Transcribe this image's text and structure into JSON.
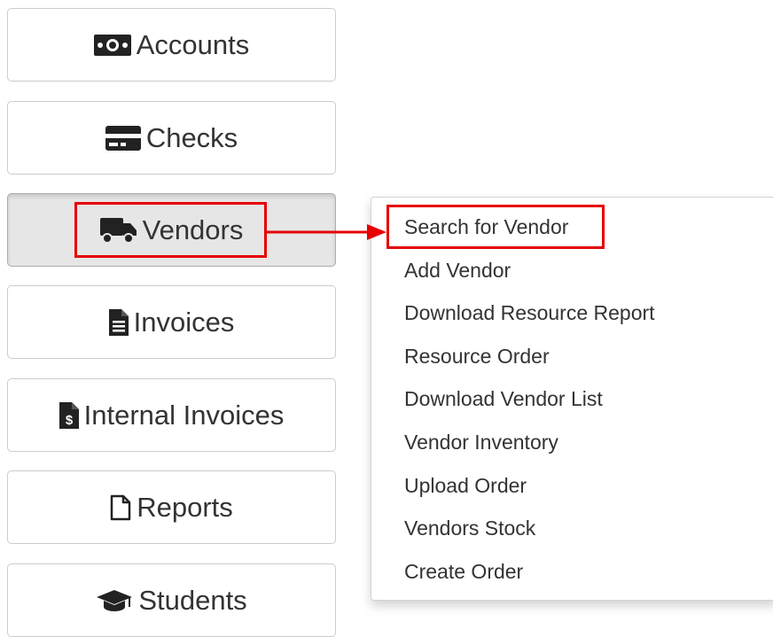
{
  "nav": {
    "buttons": [
      {
        "label": "Accounts",
        "icon": "money-bill-icon"
      },
      {
        "label": "Checks",
        "icon": "credit-card-icon"
      },
      {
        "label": "Vendors",
        "icon": "truck-icon",
        "active": true
      },
      {
        "label": "Invoices",
        "icon": "file-text-icon"
      },
      {
        "label": "Internal Invoices",
        "icon": "file-invoice-dollar-icon"
      },
      {
        "label": "Reports",
        "icon": "file-outline-icon"
      },
      {
        "label": "Students",
        "icon": "graduation-cap-icon"
      }
    ]
  },
  "vendors_menu": {
    "items": [
      "Search for Vendor",
      "Add Vendor",
      "Download Resource Report",
      "Resource Order",
      "Download Vendor List",
      "Vendor Inventory",
      "Upload Order",
      "Vendors Stock",
      "Create Order"
    ]
  },
  "colors": {
    "highlight": "#e60000",
    "active_button_bg": "#e6e6e6",
    "text": "#333333"
  }
}
